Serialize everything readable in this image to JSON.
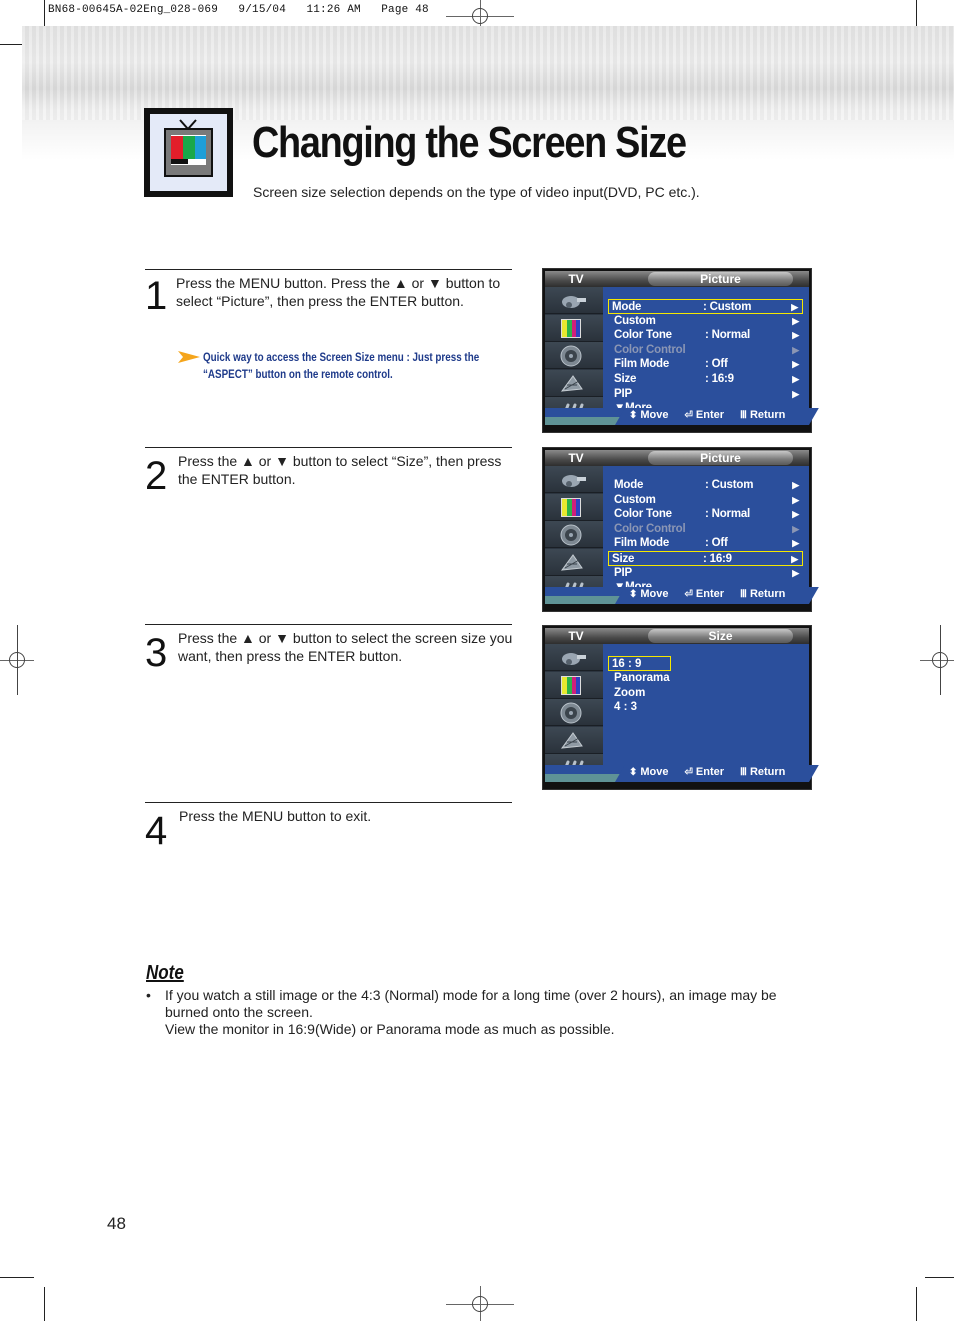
{
  "print_slug": "BN68-00645A-02Eng_028-069   9/15/04   11:26 AM   Page 48",
  "header": {
    "icon": "tv-color-bars-icon",
    "title": "Changing the Screen Size",
    "subtitle": "Screen size selection depends on the type of video input(DVD, PC etc.)."
  },
  "steps": [
    {
      "number": "1",
      "text": "Press the MENU button. Press the ▲ or ▼ button to select “Picture”, then press the ENTER button.",
      "tip": {
        "icon": "arrow-pointer-icon",
        "text": "Quick way to access the Screen Size menu : Just press the “ASPECT” button on the remote control."
      }
    },
    {
      "number": "2",
      "text": "Press the ▲ or ▼ button to select “Size”, then press the ENTER button."
    },
    {
      "number": "3",
      "text": "Press the ▲ or ▼ button to select the screen size you want, then press the ENTER button."
    },
    {
      "number": "4",
      "text": "Press the MENU button to exit."
    }
  ],
  "osd_common": {
    "tv_label": "TV",
    "side_icons": [
      "input-plug-icon",
      "picture-color-bars-icon",
      "sound-speaker-icon",
      "channel-antenna-icon",
      "setup-tools-icon"
    ],
    "footer": {
      "move_icon": "up-down-arrows-icon",
      "move": "Move",
      "enter_icon": "enter-icon",
      "enter": "Enter",
      "return_icon": "menu-return-icon",
      "return": "Return"
    },
    "colors": {
      "menu_bg": "#2b4f9c",
      "highlight": "#f4e700",
      "dim_text": "#8b96b4"
    }
  },
  "osd_screens": [
    {
      "title": "Picture",
      "selected_index": 0,
      "rows": [
        {
          "label": "Mode",
          "value": ":  Custom",
          "arrow": "▶",
          "dim": false
        },
        {
          "label": "Custom",
          "value": "",
          "arrow": "▶",
          "dim": false
        },
        {
          "label": "Color Tone",
          "value": ":  Normal",
          "arrow": "▶",
          "dim": false
        },
        {
          "label": "Color Control",
          "value": "",
          "arrow": "▶",
          "dim": true
        },
        {
          "label": "Film Mode",
          "value": ":  Off",
          "arrow": "▶",
          "dim": false
        },
        {
          "label": "Size",
          "value": ":  16:9",
          "arrow": "▶",
          "dim": false
        },
        {
          "label": "PIP",
          "value": "",
          "arrow": "▶",
          "dim": false
        },
        {
          "label": "▼More",
          "value": "",
          "arrow": "",
          "dim": false
        }
      ]
    },
    {
      "title": "Picture",
      "selected_index": 5,
      "rows": [
        {
          "label": "Mode",
          "value": ":  Custom",
          "arrow": "▶",
          "dim": false
        },
        {
          "label": "Custom",
          "value": "",
          "arrow": "▶",
          "dim": false
        },
        {
          "label": "Color Tone",
          "value": ":  Normal",
          "arrow": "▶",
          "dim": false
        },
        {
          "label": "Color Control",
          "value": "",
          "arrow": "▶",
          "dim": true
        },
        {
          "label": "Film Mode",
          "value": ":  Off",
          "arrow": "▶",
          "dim": false
        },
        {
          "label": "Size",
          "value": ":  16:9",
          "arrow": "▶",
          "dim": false
        },
        {
          "label": "PIP",
          "value": "",
          "arrow": "▶",
          "dim": false
        },
        {
          "label": "▼More",
          "value": "",
          "arrow": "",
          "dim": false
        }
      ]
    },
    {
      "title": "Size",
      "selected_index": 0,
      "options": [
        "16 : 9",
        "Panorama",
        "Zoom",
        "4 : 3"
      ]
    }
  ],
  "note": {
    "heading": "Note",
    "bullet": "•",
    "line1": "If you watch a still image or the 4:3 (Normal) mode for a long time (over 2 hours), an image may be burned onto the screen.",
    "line2": "View the monitor in 16:9(Wide) or Panorama mode as much as possible."
  },
  "page_number": "48"
}
